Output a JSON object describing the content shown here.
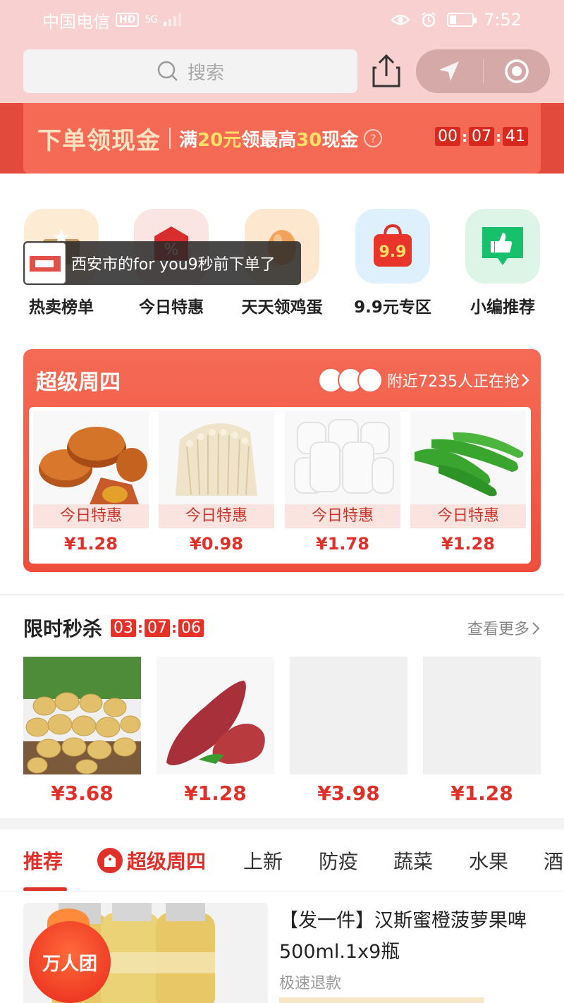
{
  "status_bar": {
    "carrier": "中国电信",
    "hd_badge": "HD",
    "network": "5G",
    "time": "7:52"
  },
  "header": {
    "search_placeholder": "搜索"
  },
  "promo_banner": {
    "headline": "下单领现金",
    "condition_prefix": "满",
    "condition_amount1": "20元",
    "condition_middle": "领最高",
    "condition_amount2": "30",
    "condition_suffix": "现金",
    "help_mark": "?",
    "countdown": [
      "00",
      "07",
      "41"
    ]
  },
  "categories": [
    {
      "label": "热卖榜单",
      "icon": "trophy-icon"
    },
    {
      "label": "今日特惠",
      "icon": "discount-tag-icon"
    },
    {
      "label": "天天领鸡蛋",
      "icon": "egg-icon"
    },
    {
      "label": "9.9元专区",
      "icon": "shopping-bag-icon",
      "icon_text": "9.9"
    },
    {
      "label": "小编推荐",
      "icon": "thumbs-up-icon"
    }
  ],
  "order_toast": {
    "text": "西安市的for you9秒前下单了"
  },
  "super_thursday": {
    "title": "超级周四",
    "nearby_text": "附近7235人正在抢",
    "products": [
      {
        "tag": "今日特惠",
        "price": "¥1.28",
        "image": "mooncake"
      },
      {
        "tag": "今日特惠",
        "price": "¥0.98",
        "image": "enoki-mushroom"
      },
      {
        "tag": "今日特惠",
        "price": "¥1.78",
        "image": "steamed-buns"
      },
      {
        "tag": "今日特惠",
        "price": "¥1.28",
        "image": "green-peppers"
      }
    ]
  },
  "flash_sale": {
    "title": "限时秒杀",
    "countdown": [
      "03",
      "07",
      "06"
    ],
    "more_label": "查看更多",
    "products": [
      {
        "price": "¥3.68",
        "image": "potatoes"
      },
      {
        "price": "¥1.28",
        "image": "sweet-potatoes"
      },
      {
        "price": "¥3.98",
        "image": "placeholder"
      },
      {
        "price": "¥1.28",
        "image": "placeholder"
      }
    ]
  },
  "tabs": [
    {
      "label": "推荐",
      "active": true
    },
    {
      "label": "超级周四",
      "highlight": true
    },
    {
      "label": "上新"
    },
    {
      "label": "防疫"
    },
    {
      "label": "蔬菜"
    },
    {
      "label": "水果"
    },
    {
      "label": "酒"
    }
  ],
  "product_card": {
    "badge": "万人团",
    "title": "【发一件】汉斯蜜橙菠萝果啤500ml.1x9瓶",
    "subtitle": "极速退款"
  },
  "colors": {
    "accent_red": "#e0302a",
    "header_pink": "#f8d0cf",
    "banner_orange": "#f46a55"
  }
}
